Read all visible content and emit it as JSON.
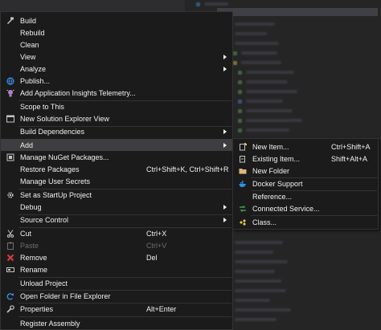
{
  "colors": {
    "menu_bg": "#1b1b1c",
    "highlight": "#3e3e40",
    "border": "#333337",
    "text": "#f1f1f1",
    "disabled": "#6d6d6d",
    "accent_blue": "#3c8be0",
    "accent_red": "#e03c3c",
    "accent_purple": "#b180d7"
  },
  "menu": {
    "build": "Build",
    "rebuild": "Rebuild",
    "clean": "Clean",
    "view": "View",
    "analyze": "Analyze",
    "publish": "Publish...",
    "add_insights": "Add Application Insights Telemetry...",
    "scope_to_this": "Scope to This",
    "new_solution_explorer_view": "New Solution Explorer View",
    "build_dependencies": "Build Dependencies",
    "add": "Add",
    "manage_nuget": "Manage NuGet Packages...",
    "restore_packages": "Restore Packages",
    "restore_packages_shortcut": "Ctrl+Shift+K, Ctrl+Shift+R",
    "manage_user_secrets": "Manage User Secrets",
    "set_startup": "Set as StartUp Project",
    "debug": "Debug",
    "source_control": "Source Control",
    "cut": "Cut",
    "cut_shortcut": "Ctrl+X",
    "paste": "Paste",
    "paste_shortcut": "Ctrl+V",
    "remove": "Remove",
    "remove_shortcut": "Del",
    "rename": "Rename",
    "unload_project": "Unload Project",
    "open_folder": "Open Folder in File Explorer",
    "properties": "Properties",
    "properties_shortcut": "Alt+Enter",
    "register_assembly": "Register Assembly"
  },
  "submenu": {
    "new_item": "New Item...",
    "new_item_shortcut": "Ctrl+Shift+A",
    "existing_item": "Existing Item...",
    "existing_item_shortcut": "Shift+Alt+A",
    "new_folder": "New Folder",
    "docker_support": "Docker Support",
    "reference": "Reference...",
    "connected_service": "Connected Service...",
    "class": "Class..."
  }
}
